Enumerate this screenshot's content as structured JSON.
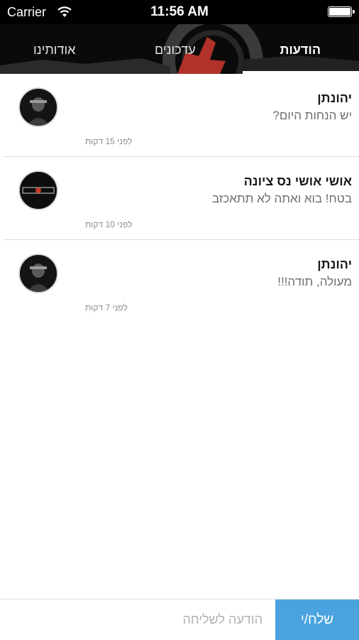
{
  "status_bar": {
    "carrier": "Carrier",
    "time": "11:56 AM",
    "wifi_icon": "wifi-icon",
    "battery_icon": "battery-icon"
  },
  "tabs": [
    {
      "label": "הודעות",
      "selected": true
    },
    {
      "label": "עדכונים",
      "selected": false
    },
    {
      "label": "אודותינו",
      "selected": false
    }
  ],
  "messages": [
    {
      "name": "יהונתן",
      "text": "יש הנחות היום?",
      "time_ago": "לפני 15 דקות",
      "avatar_icon": "person-avatar-icon"
    },
    {
      "name": "אושי אושי נס ציונה",
      "text": "בטח! בוא ואתה לא תתאכזב",
      "time_ago": "לפני 10 דקות",
      "avatar_icon": "restaurant-logo-avatar-icon"
    },
    {
      "name": "יהונתן",
      "text": "מעולה, תודה!!!",
      "time_ago": "לפני 7 דקות",
      "avatar_icon": "person-avatar-icon"
    }
  ],
  "composer": {
    "placeholder": "הודעה לשליחה",
    "send_label": "שלח/י"
  },
  "colors": {
    "accent": "#4aa3df",
    "header_bg": "#0a0a0a",
    "brand_red": "#c0392b"
  }
}
